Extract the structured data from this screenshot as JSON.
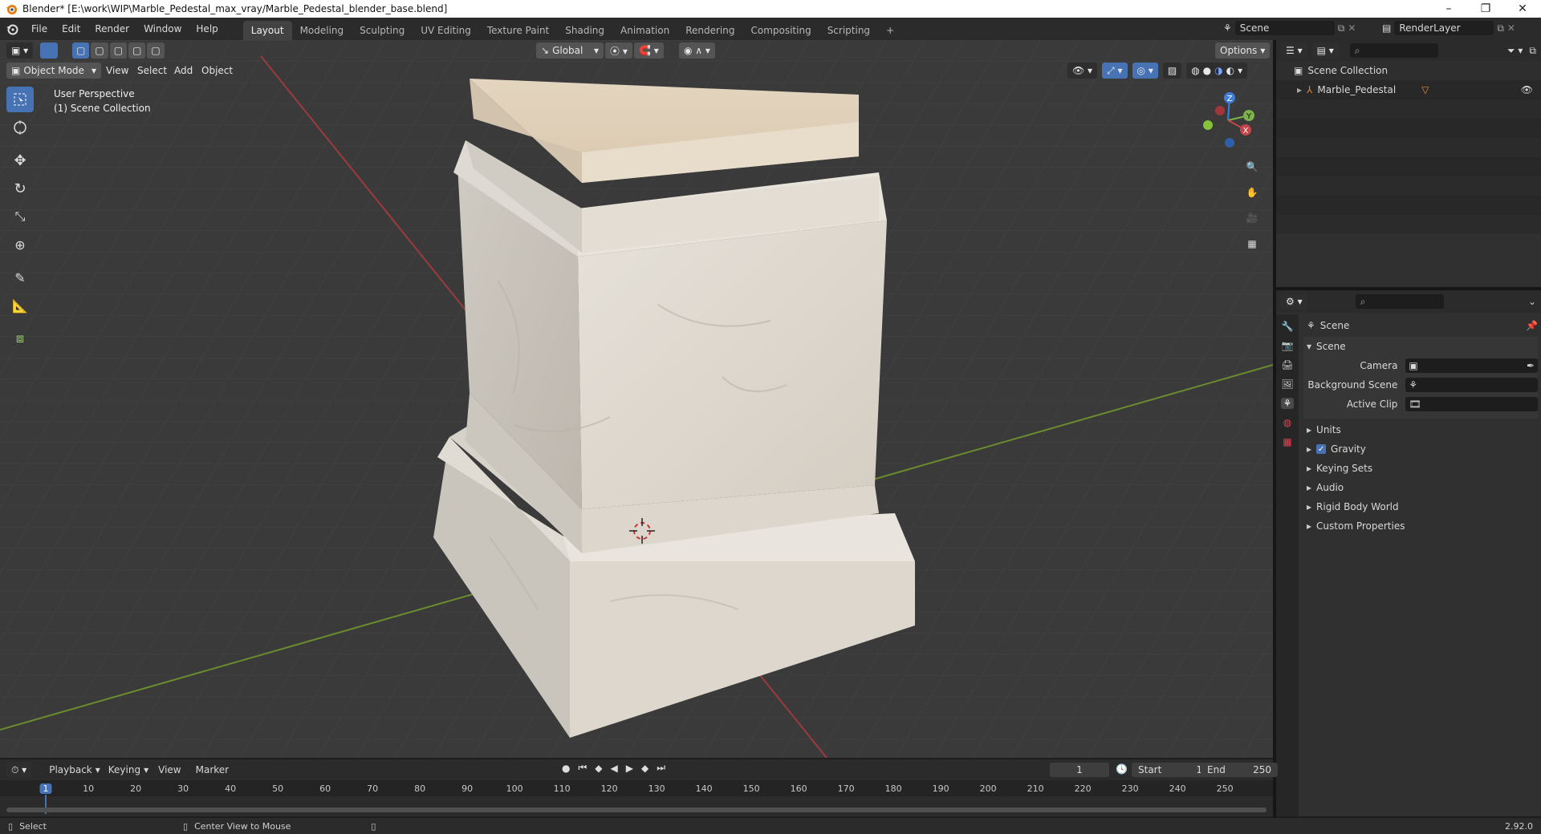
{
  "window": {
    "title": "Blender* [E:\\work\\WIP\\Marble_Pedestal_max_vray/Marble_Pedestal_blender_base.blend]",
    "controls": [
      "–",
      "❐",
      "✕"
    ]
  },
  "menu": [
    "File",
    "Edit",
    "Render",
    "Window",
    "Help"
  ],
  "workspaces": [
    "Layout",
    "Modeling",
    "Sculpting",
    "UV Editing",
    "Texture Paint",
    "Shading",
    "Animation",
    "Rendering",
    "Compositing",
    "Scripting",
    "+"
  ],
  "active_workspace": "Layout",
  "scene_selector": "Scene",
  "renderlayer_selector": "RenderLayer",
  "viewport": {
    "transform_orientation": "Global",
    "options_label": "Options",
    "mode": "Object Mode",
    "menus": [
      "View",
      "Select",
      "Add",
      "Object"
    ],
    "perspective_label": "User Perspective",
    "collection_label": "(1) Scene Collection",
    "gizmo_axes": [
      "Z",
      "Y",
      "X"
    ]
  },
  "outliner": {
    "collection": "Scene Collection",
    "object": "Marble_Pedestal"
  },
  "properties": {
    "context_title": "Scene",
    "panel_title": "Scene",
    "fields": [
      {
        "label": "Camera",
        "value": ""
      },
      {
        "label": "Background Scene",
        "value": ""
      },
      {
        "label": "Active Clip",
        "value": ""
      }
    ],
    "sections": [
      "Units",
      "Gravity",
      "Keying Sets",
      "Audio",
      "Rigid Body World",
      "Custom Properties"
    ],
    "gravity_checked": true
  },
  "timeline": {
    "menus": [
      "Playback",
      "Keying",
      "View",
      "Marker"
    ],
    "current_frame": "1",
    "start_label": "Start",
    "start": "1",
    "end_label": "End",
    "end": "250",
    "ticks": [
      1,
      10,
      20,
      30,
      40,
      50,
      60,
      70,
      80,
      90,
      100,
      110,
      120,
      130,
      140,
      150,
      160,
      170,
      180,
      190,
      200,
      210,
      220,
      230,
      240,
      250
    ]
  },
  "statusbar": {
    "left": "Select",
    "middle": "Center View to Mouse",
    "version": "2.92.0"
  },
  "colors": {
    "accent": "#4772b3",
    "x_axis": "#c4454a",
    "y_axis": "#7cb24a",
    "z_axis": "#3e7fd8"
  }
}
